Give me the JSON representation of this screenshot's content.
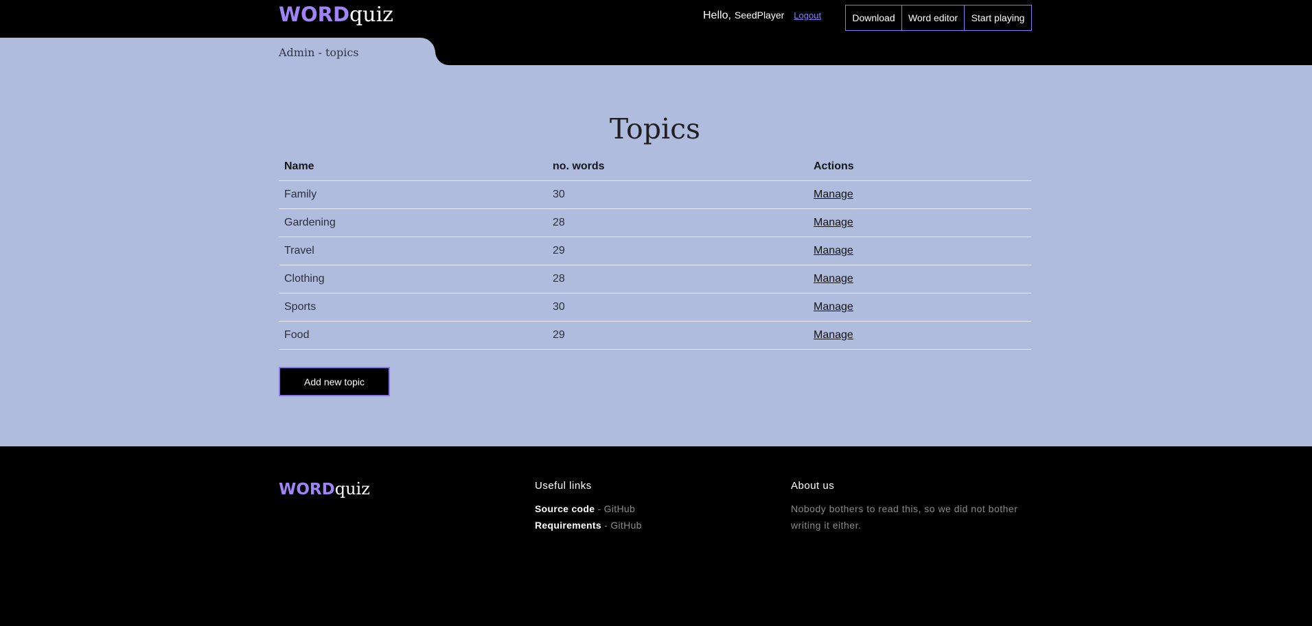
{
  "header": {
    "logo_word": "WORD",
    "logo_quiz": "quiz",
    "hello": "Hello,",
    "username": "SeedPlayer",
    "logout": "Logout",
    "nav": [
      "Download",
      "Word editor",
      "Start playing"
    ]
  },
  "breadcrumb": "Admin - topics",
  "page_title": "Topics",
  "table": {
    "columns": [
      "Name",
      "no. words",
      "Actions"
    ],
    "rows": [
      {
        "name": "Family",
        "words": "30",
        "action": "Manage"
      },
      {
        "name": "Gardening",
        "words": "28",
        "action": "Manage"
      },
      {
        "name": "Travel",
        "words": "29",
        "action": "Manage"
      },
      {
        "name": "Clothing",
        "words": "28",
        "action": "Manage"
      },
      {
        "name": "Sports",
        "words": "30",
        "action": "Manage"
      },
      {
        "name": "Food",
        "words": "29",
        "action": "Manage"
      }
    ]
  },
  "add_button": "Add new topic",
  "footer": {
    "logo_word": "WORD",
    "logo_quiz": "quiz",
    "useful_links": {
      "heading": "Useful links",
      "items": [
        {
          "label": "Source code",
          "sep": " - ",
          "link": "GitHub"
        },
        {
          "label": "Requirements",
          "sep": " - ",
          "link": "GitHub"
        }
      ]
    },
    "about": {
      "heading": "About us",
      "text": "Nobody bothers to read this, so we did not bother writing it either."
    }
  },
  "colors": {
    "accent": "#9f84f5",
    "content_bg": "#b0bcdd",
    "chrome_bg": "#000000"
  }
}
